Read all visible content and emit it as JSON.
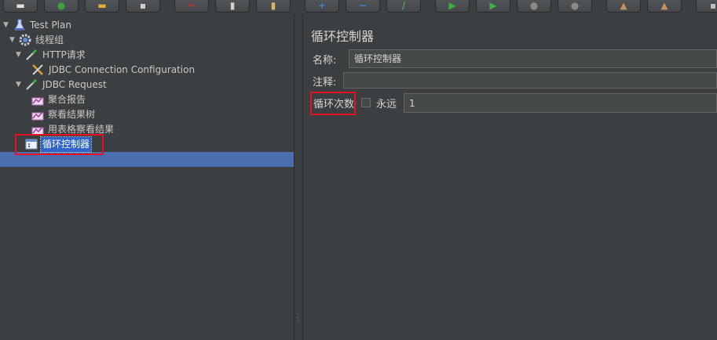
{
  "toolbar": {
    "buttons": [
      {
        "icon": "new-icon",
        "glyph": "▬",
        "color": "#e0e0e0"
      },
      {
        "icon": "templates-icon",
        "glyph": "●",
        "color": "#3e9e3e"
      },
      {
        "icon": "open-icon",
        "glyph": "▬",
        "color": "#e0b030"
      },
      {
        "icon": "save-icon",
        "glyph": "▪",
        "color": "#d0d0d0"
      },
      {
        "icon": "cut-icon",
        "glyph": "✂",
        "color": "#d83030"
      },
      {
        "icon": "copy-icon",
        "glyph": "▮",
        "color": "#d0d0d0"
      },
      {
        "icon": "paste-icon",
        "glyph": "▮",
        "color": "#d8b860"
      },
      {
        "icon": "expand-icon",
        "glyph": "+",
        "color": "#4a90e2"
      },
      {
        "icon": "collapse-icon",
        "glyph": "−",
        "color": "#4a90e2"
      },
      {
        "icon": "toggle-icon",
        "glyph": "/",
        "color": "#5bb85b"
      },
      {
        "icon": "start-icon",
        "glyph": "▶",
        "color": "#3cb043"
      },
      {
        "icon": "start-no-pauses-icon",
        "glyph": "▶",
        "color": "#3cb043"
      },
      {
        "icon": "stop-icon",
        "glyph": "●",
        "color": "#8a8a8a"
      },
      {
        "icon": "shutdown-icon",
        "glyph": "●",
        "color": "#8a8a8a"
      },
      {
        "icon": "clear-icon",
        "glyph": "▲",
        "color": "#c09060"
      },
      {
        "icon": "clear-all-icon",
        "glyph": "▲",
        "color": "#c09060"
      },
      {
        "icon": "search-icon",
        "glyph": "▪",
        "color": "#c0c0c0"
      }
    ]
  },
  "tree": {
    "nodes": [
      {
        "label": "Test Plan",
        "icon": "test-plan-icon"
      },
      {
        "label": "线程组",
        "icon": "thread-group-gear-icon"
      },
      {
        "label": "HTTP请求",
        "icon": "sampler-pipette-icon"
      },
      {
        "label": "JDBC Connection Configuration",
        "icon": "config-wrench-icon"
      },
      {
        "label": "JDBC Request",
        "icon": "sampler-pipette-icon"
      },
      {
        "label": "聚合报告",
        "icon": "listener-chart-icon"
      },
      {
        "label": "察看结果树",
        "icon": "listener-chart-icon"
      },
      {
        "label": "用表格察看结果",
        "icon": "listener-chart-icon"
      },
      {
        "label": "循环控制器",
        "icon": "controller-icon"
      }
    ]
  },
  "panel": {
    "title": "循环控制器",
    "name_label": "名称:",
    "name_value": "循环控制器",
    "comment_label": "注释:",
    "comment_value": "",
    "loop_label": "循环次数",
    "forever_label": "永远",
    "forever_checked": false,
    "loop_value": "1"
  },
  "colors": {
    "background": "#3c3f41",
    "selection": "#4b6eaf",
    "highlight_box": "#e81123"
  }
}
